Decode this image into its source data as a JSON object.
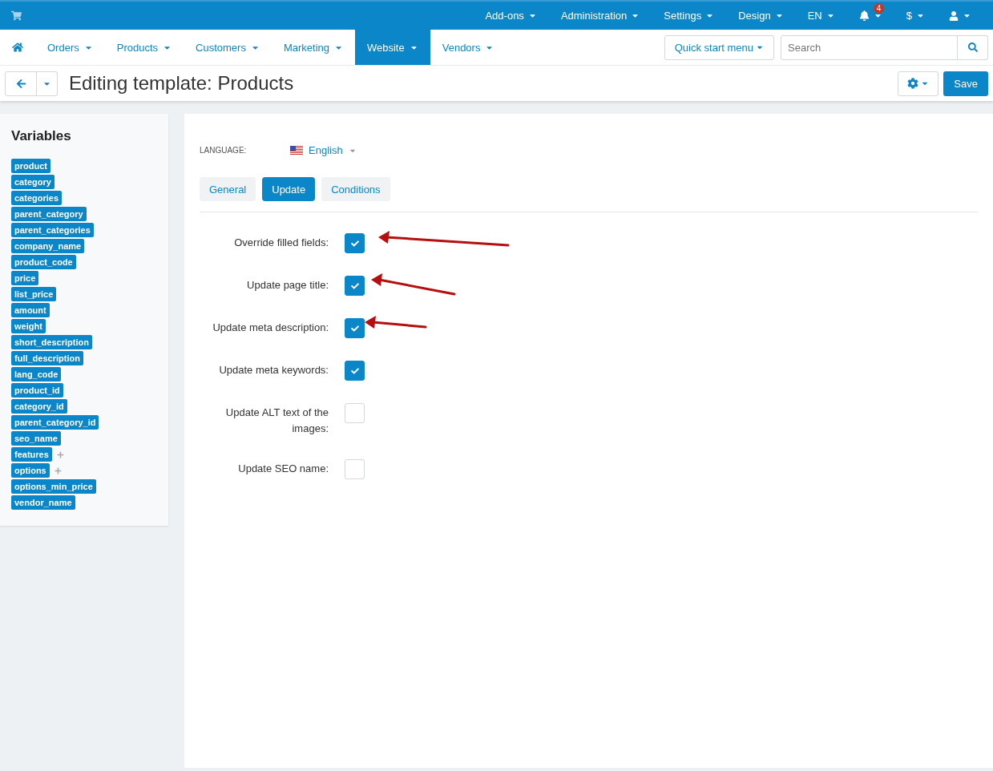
{
  "top_bar": {
    "menus": [
      {
        "label": "Add-ons",
        "kind": "text"
      },
      {
        "label": "Administration",
        "kind": "text"
      },
      {
        "label": "Settings",
        "kind": "text"
      },
      {
        "label": "Design",
        "kind": "text"
      },
      {
        "label": "EN",
        "kind": "text"
      },
      {
        "kind": "bell",
        "badge": "4"
      },
      {
        "label": "$",
        "kind": "text"
      },
      {
        "kind": "user"
      }
    ]
  },
  "main_nav": {
    "items": [
      {
        "label": "Orders",
        "selected": false
      },
      {
        "label": "Products",
        "selected": false
      },
      {
        "label": "Customers",
        "selected": false
      },
      {
        "label": "Marketing",
        "selected": false
      },
      {
        "label": "Website",
        "selected": true
      },
      {
        "label": "Vendors",
        "selected": false
      }
    ],
    "quick_start": "Quick start menu",
    "search": {
      "placeholder": "Search"
    }
  },
  "title_bar": {
    "title": "Editing template: Products",
    "save": "Save"
  },
  "sidebar": {
    "title": "Variables",
    "items": [
      {
        "label": "product",
        "expandable": false
      },
      {
        "label": "category",
        "expandable": false
      },
      {
        "label": "categories",
        "expandable": false
      },
      {
        "label": "parent_category",
        "expandable": false
      },
      {
        "label": "parent_categories",
        "expandable": false
      },
      {
        "label": "company_name",
        "expandable": false
      },
      {
        "label": "product_code",
        "expandable": false
      },
      {
        "label": "price",
        "expandable": false
      },
      {
        "label": "list_price",
        "expandable": false
      },
      {
        "label": "amount",
        "expandable": false
      },
      {
        "label": "weight",
        "expandable": false
      },
      {
        "label": "short_description",
        "expandable": false
      },
      {
        "label": "full_description",
        "expandable": false
      },
      {
        "label": "lang_code",
        "expandable": false
      },
      {
        "label": "product_id",
        "expandable": false
      },
      {
        "label": "category_id",
        "expandable": false
      },
      {
        "label": "parent_category_id",
        "expandable": false
      },
      {
        "label": "seo_name",
        "expandable": false
      },
      {
        "label": "features",
        "expandable": true
      },
      {
        "label": "options",
        "expandable": true
      },
      {
        "label": "options_min_price",
        "expandable": false
      },
      {
        "label": "vendor_name",
        "expandable": false
      }
    ]
  },
  "language": {
    "label": "LANGUAGE:",
    "value": "English"
  },
  "tabs": [
    {
      "label": "General",
      "selected": false
    },
    {
      "label": "Update",
      "selected": true
    },
    {
      "label": "Conditions",
      "selected": false
    }
  ],
  "fields": [
    {
      "label": "Override filled fields:",
      "checked": true,
      "annotated": true
    },
    {
      "label": "Update page title:",
      "checked": true,
      "annotated": true
    },
    {
      "label": "Update meta description:",
      "checked": true,
      "annotated": true
    },
    {
      "label": "Update meta keywords:",
      "checked": true,
      "annotated": false
    },
    {
      "label": "Update ALT text of the images:",
      "checked": false,
      "annotated": false
    },
    {
      "label": "Update SEO name:",
      "checked": false,
      "annotated": false
    }
  ]
}
